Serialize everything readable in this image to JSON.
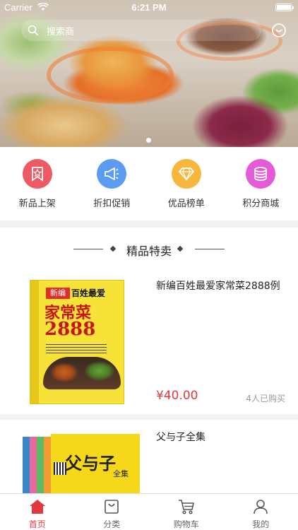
{
  "status_bar": {
    "carrier": "Carrier",
    "time": "6:21 PM"
  },
  "search": {
    "placeholder": "搜索商"
  },
  "categories": [
    {
      "label": "新品上架",
      "color": "#ee5a63",
      "icon": "new-tag-icon"
    },
    {
      "label": "折扣促销",
      "color": "#5b9cf2",
      "icon": "megaphone-icon"
    },
    {
      "label": "优品榜单",
      "color": "#f6b73c",
      "icon": "diamond-icon"
    },
    {
      "label": "积分商城",
      "color": "#e55ad7",
      "icon": "coins-icon"
    }
  ],
  "section": {
    "title": "精品特卖"
  },
  "products": [
    {
      "name": "新编百姓最爱家常菜2888例",
      "price": "¥40.00",
      "sold": "4人已购买",
      "cover": {
        "tag": "新编",
        "line1": "百姓最爱",
        "line2": "家常菜",
        "number": "2888"
      }
    },
    {
      "name": "父与子全集",
      "cover": {
        "title": "父与子",
        "sub": "全集"
      }
    }
  ],
  "tabbar": [
    {
      "label": "首页",
      "icon": "home-icon",
      "active": true
    },
    {
      "label": "分类",
      "icon": "bag-icon",
      "active": false
    },
    {
      "label": "购物车",
      "icon": "cart-icon",
      "active": false
    },
    {
      "label": "我的",
      "icon": "user-icon",
      "active": false
    }
  ],
  "colors": {
    "accent": "#e0393e",
    "price": "#e0393e"
  },
  "banner": {
    "current_slide": 1
  }
}
